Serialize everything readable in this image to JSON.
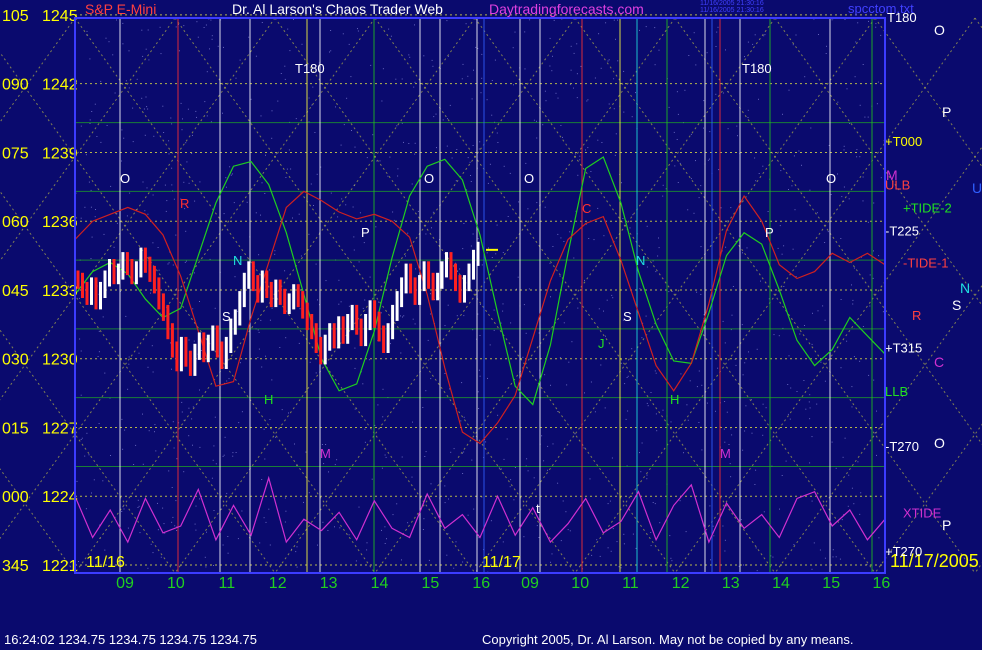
{
  "header": {
    "instrument": "S&P E-Mini",
    "site_title": "Dr. Al Larson's Chaos Trader Web",
    "site_url": "Daytradingforecasts.com",
    "time_lines": [
      "11/16/2005 21:30:16",
      "11/16/2005 21:30:16"
    ],
    "filename": "spcctom.txt"
  },
  "footer": {
    "status": "16:24:02  1234.75 1234.75 1234.75 1234.75",
    "copyright": "Copyright 2005, Dr. Al Larson. May not be copied by any means."
  },
  "colors": {
    "background": "#0a0a6e",
    "price_up": "#ffffff",
    "price_down": "#ff2020",
    "tide_green": "#1fcf1f",
    "tide_red": "#d02020",
    "xtide": "#d030d0",
    "grid_yellow": "#e0e040",
    "grid_green": "#20b020",
    "axis_label": "#ffff00",
    "time_label": "#20d020"
  },
  "chart_data": {
    "type": "line",
    "title": "S&P E-Mini",
    "y_axis": {
      "degrees": [
        "105",
        "090",
        "075",
        "060",
        "045",
        "030",
        "015",
        "000",
        "345"
      ],
      "prices": [
        1245,
        1242,
        1239,
        1236,
        1233,
        1230,
        1227,
        1224,
        1221
      ],
      "ylim": [
        1221,
        1245
      ]
    },
    "x_axis": {
      "day_labels": [
        "11/16",
        "11/17",
        "11/17/2005"
      ],
      "day1_hours": [
        "09",
        "10",
        "11",
        "12",
        "13",
        "14",
        "15",
        "16"
      ],
      "day2_hours": [
        "09",
        "10",
        "11",
        "12",
        "13",
        "14",
        "15",
        "16"
      ]
    },
    "right_labels": [
      {
        "text": "T180",
        "price": 1244.9,
        "color": "#ffffff"
      },
      {
        "text": "+T000",
        "price": 1239.5,
        "color": "#ffff00"
      },
      {
        "text": "ULB",
        "price": 1237.6,
        "color": "#ff4040"
      },
      {
        "text": "+TIDE-2",
        "price": 1236.6,
        "color": "#20e020"
      },
      {
        "text": "-T225",
        "price": 1235.6,
        "color": "#ffffff"
      },
      {
        "text": "-TIDE-1",
        "price": 1234.2,
        "color": "#ff4040"
      },
      {
        "text": "R",
        "price": 1231.9,
        "color": "#ff4040"
      },
      {
        "text": "+T315",
        "price": 1230.5,
        "color": "#ffffff"
      },
      {
        "text": "LLB",
        "price": 1228.6,
        "color": "#20e020"
      },
      {
        "text": "-T270",
        "price": 1226.2,
        "color": "#ffffff"
      },
      {
        "text": "XTIDE",
        "price": 1223.3,
        "color": "#d030d0"
      },
      {
        "text": "+T270",
        "price": 1221.6,
        "color": "#ffffff"
      }
    ],
    "planet_markers": [
      "O",
      "P",
      "U",
      "M",
      "N",
      "S",
      "C",
      "O",
      "P"
    ],
    "chart_letters": [
      "T180",
      "T180",
      "O",
      "O",
      "O",
      "O",
      "P",
      "P",
      "N",
      "N",
      "S",
      "S",
      "C",
      "H",
      "H",
      "J",
      "M",
      "M",
      "R",
      "t"
    ],
    "price_bars": {
      "open_price": 1233.5,
      "close_price": 1234.75,
      "series": [
        1233.4,
        1233.0,
        1232.7,
        1233.2,
        1232.5,
        1233.0,
        1233.5,
        1234.0,
        1233.6,
        1233.8,
        1234.3,
        1234.0,
        1233.6,
        1233.9,
        1234.5,
        1234.1,
        1233.7,
        1233.2,
        1232.5,
        1232.0,
        1231.2,
        1230.4,
        1229.8,
        1230.6,
        1230.0,
        1229.6,
        1230.3,
        1230.8,
        1230.2,
        1230.7,
        1231.1,
        1230.4,
        1229.9,
        1230.6,
        1231.4,
        1231.8,
        1232.6,
        1233.4,
        1233.9,
        1233.3,
        1232.8,
        1233.5,
        1233.0,
        1232.6,
        1233.1,
        1232.7,
        1232.3,
        1232.5,
        1232.9,
        1232.6,
        1232.1,
        1231.6,
        1231.2,
        1230.6,
        1230.1,
        1230.7,
        1231.2,
        1230.8,
        1231.5,
        1231.0,
        1231.6,
        1232.0,
        1231.4,
        1230.9,
        1231.6,
        1232.2,
        1231.7,
        1231.1,
        1230.6,
        1231.2,
        1232.0,
        1232.6,
        1233.2,
        1233.8,
        1233.2,
        1232.7,
        1233.3,
        1233.9,
        1233.4,
        1232.9,
        1233.4,
        1233.9,
        1234.3,
        1233.8,
        1233.3,
        1232.8,
        1233.3,
        1233.8,
        1234.4,
        1234.75
      ]
    },
    "series": [
      {
        "name": "TIDE-2",
        "color": "#1fcf1f",
        "values": [
          1232.8,
          1233.8,
          1234.2,
          1233.7,
          1232.6,
          1231.8,
          1232.2,
          1234.5,
          1236.8,
          1238.4,
          1238.6,
          1237.6,
          1235.5,
          1232.8,
          1230.0,
          1228.6,
          1228.9,
          1231.2,
          1234.4,
          1237.1,
          1238.4,
          1238.7,
          1237.8,
          1235.4,
          1232.0,
          1228.8,
          1228.0,
          1230.6,
          1234.6,
          1238.3,
          1238.8,
          1236.8,
          1233.8,
          1231.5,
          1229.9,
          1229.8,
          1232.0,
          1234.5,
          1235.5,
          1235.0,
          1233.0,
          1230.8,
          1229.7,
          1230.4,
          1231.8,
          1231.0,
          1230.2
        ]
      },
      {
        "name": "TIDE-1",
        "color": "#d02020",
        "values": [
          1235.2,
          1236.0,
          1236.3,
          1236.6,
          1236.3,
          1235.4,
          1233.6,
          1231.2,
          1228.8,
          1229.0,
          1231.8,
          1234.2,
          1236.6,
          1237.3,
          1236.9,
          1236.4,
          1236.1,
          1236.3,
          1236.0,
          1235.3,
          1232.8,
          1229.6,
          1226.8,
          1226.3,
          1227.2,
          1228.4,
          1230.9,
          1233.4,
          1235.2,
          1235.9,
          1236.2,
          1234.3,
          1232.0,
          1229.7,
          1228.6,
          1229.8,
          1232.4,
          1235.6,
          1237.1,
          1236.0,
          1234.1,
          1233.5,
          1233.8,
          1234.6,
          1234.2,
          1234.6,
          1234.1
        ]
      },
      {
        "name": "XTIDE",
        "color": "#d030d0",
        "values": [
          1224.0,
          1222.2,
          1223.4,
          1222.0,
          1223.9,
          1222.4,
          1222.7,
          1224.3,
          1222.1,
          1223.6,
          1222.3,
          1224.8,
          1222.0,
          1223.0,
          1222.5,
          1223.3,
          1222.1,
          1223.8,
          1222.6,
          1222.2,
          1224.1,
          1222.6,
          1223.2,
          1222.2,
          1224.0,
          1222.3,
          1223.5,
          1222.0,
          1222.8,
          1223.9,
          1222.4,
          1222.9,
          1224.2,
          1222.1,
          1223.6,
          1224.5,
          1222.0,
          1223.7,
          1222.6,
          1223.2,
          1222.2,
          1223.9,
          1224.2,
          1222.7,
          1223.4,
          1222.1,
          1223.0
        ]
      }
    ]
  }
}
